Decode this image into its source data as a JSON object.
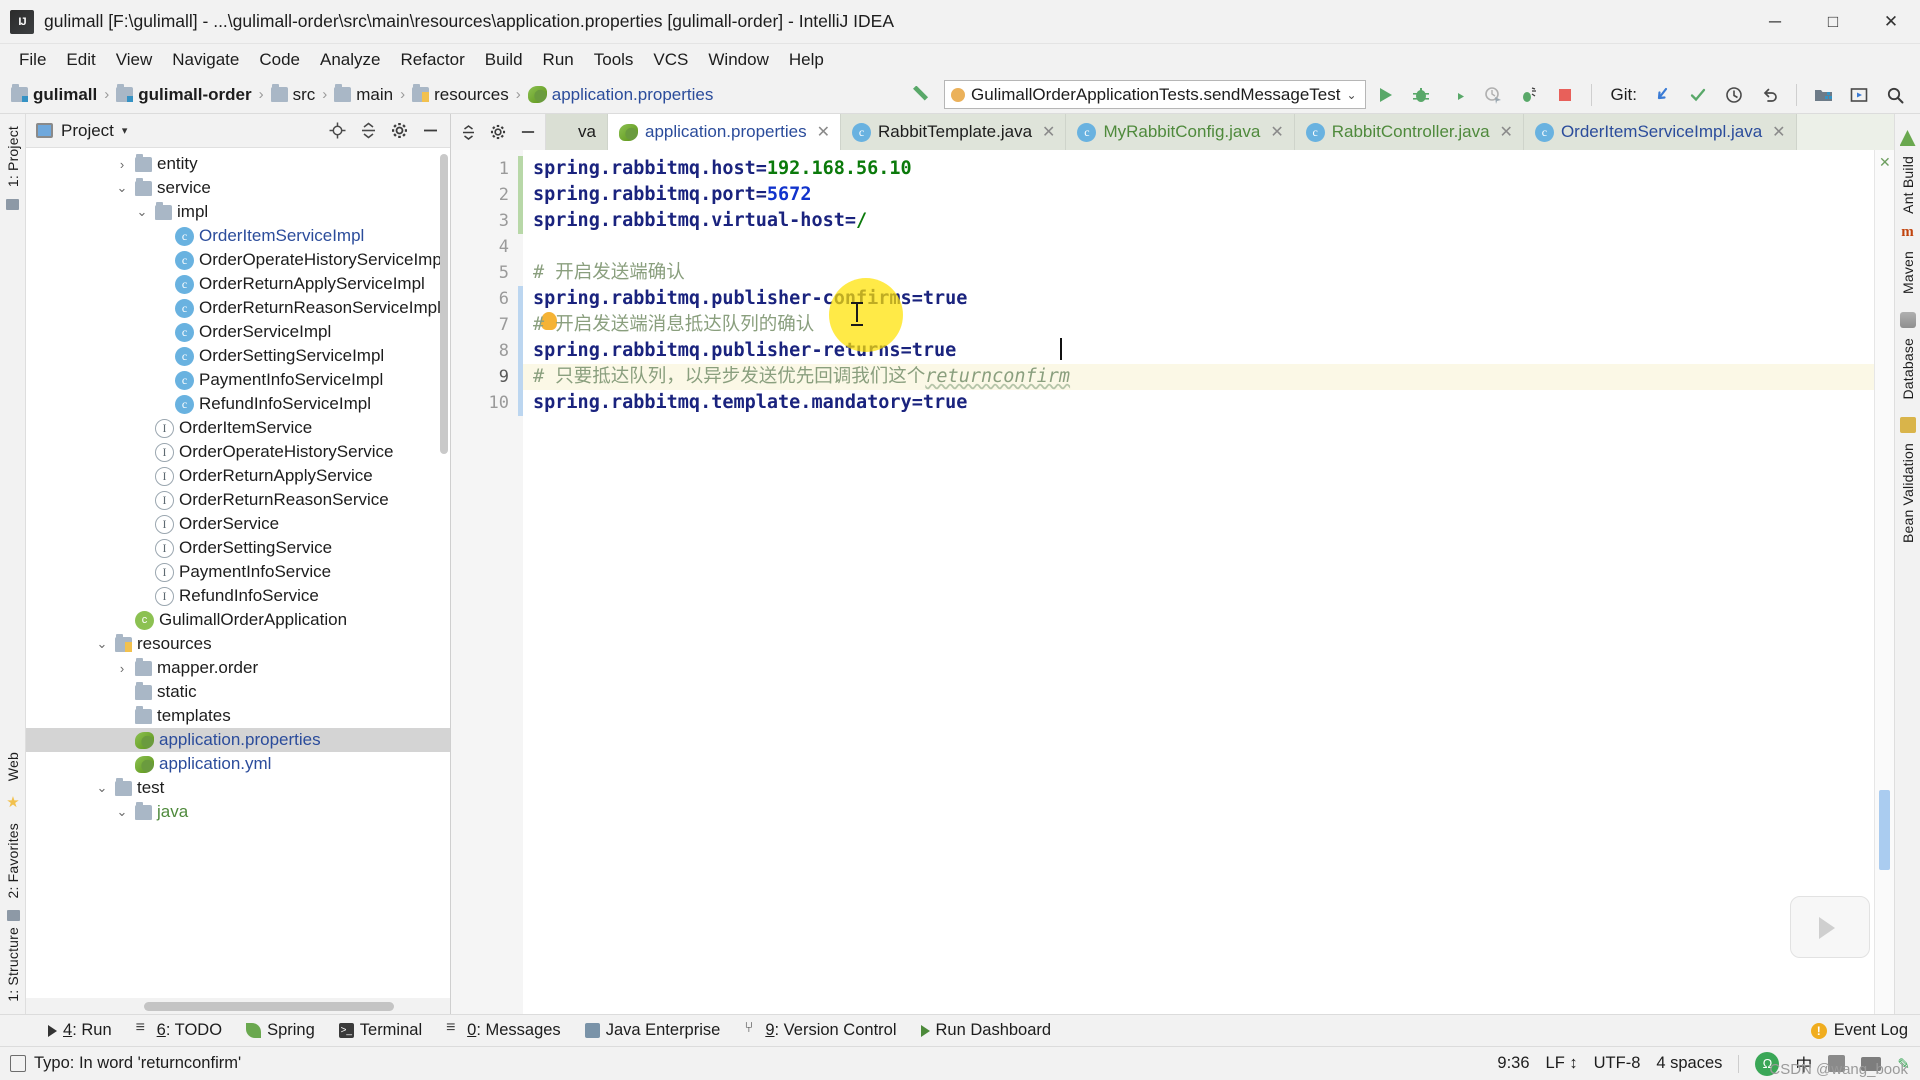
{
  "window": {
    "title": "gulimall [F:\\gulimall] - ...\\gulimall-order\\src\\main\\resources\\application.properties [gulimall-order] - IntelliJ IDEA",
    "logo_text": "IJ",
    "minimize": "─",
    "maximize": "□",
    "close": "✕"
  },
  "menubar": [
    "File",
    "Edit",
    "View",
    "Navigate",
    "Code",
    "Analyze",
    "Refactor",
    "Build",
    "Run",
    "Tools",
    "VCS",
    "Window",
    "Help"
  ],
  "navbar": {
    "breadcrumbs": [
      {
        "label": "gulimall",
        "icon": "module-folder-icon",
        "bold": true,
        "color": "dark"
      },
      {
        "label": "gulimall-order",
        "icon": "module-folder-icon",
        "bold": true,
        "color": "dark"
      },
      {
        "label": "src",
        "icon": "folder-icon",
        "bold": false,
        "color": "dark"
      },
      {
        "label": "main",
        "icon": "folder-icon",
        "bold": false,
        "color": "dark"
      },
      {
        "label": "resources",
        "icon": "resources-folder-icon",
        "bold": false,
        "color": "dark"
      },
      {
        "label": "application.properties",
        "icon": "properties-file-icon",
        "bold": false,
        "color": "blue"
      }
    ],
    "separator": "›",
    "run_config": "GulimallOrderApplicationTests.sendMessageTest",
    "run_config_chevron": "⌄",
    "git_label": "Git:",
    "toolbar_icons": [
      "run-icon",
      "debug-icon",
      "run-with-coverage-icon",
      "profile-icon",
      "run-tests-icon",
      "stop-icon",
      "git-update-icon",
      "git-commit-icon",
      "git-history-icon",
      "git-rollback-icon",
      "project-structure-icon",
      "run-anything-icon",
      "search-everywhere-icon"
    ]
  },
  "left_strip": {
    "project_label": "1: Project",
    "structure_label": "1: Structure",
    "favorites_label": "2: Favorites",
    "web_label": "Web"
  },
  "right_strip": {
    "items": [
      "Ant Build",
      "Maven",
      "Database",
      "Bean Validation"
    ]
  },
  "project_pane": {
    "title": "Project",
    "caret": "▾",
    "tools": [
      "locate-icon",
      "collapse-all-icon",
      "settings-icon",
      "hide-icon"
    ],
    "tree": [
      {
        "label": "entity",
        "icon": "folder-icon",
        "indent": 4,
        "twisty": "›",
        "selected": false,
        "color": "dark"
      },
      {
        "label": "service",
        "icon": "folder-icon",
        "indent": 4,
        "twisty": "⌄",
        "selected": false,
        "color": "dark"
      },
      {
        "label": "impl",
        "icon": "folder-icon",
        "indent": 5,
        "twisty": "⌄",
        "selected": false,
        "color": "dark"
      },
      {
        "label": "OrderItemServiceImpl",
        "icon": "class-icon",
        "indent": 6,
        "twisty": "",
        "selected": false,
        "color": "blue"
      },
      {
        "label": "OrderOperateHistoryServiceImpl",
        "icon": "class-icon",
        "indent": 6,
        "twisty": "",
        "selected": false,
        "color": "dark"
      },
      {
        "label": "OrderReturnApplyServiceImpl",
        "icon": "class-icon",
        "indent": 6,
        "twisty": "",
        "selected": false,
        "color": "dark"
      },
      {
        "label": "OrderReturnReasonServiceImpl",
        "icon": "class-icon",
        "indent": 6,
        "twisty": "",
        "selected": false,
        "color": "dark"
      },
      {
        "label": "OrderServiceImpl",
        "icon": "class-icon",
        "indent": 6,
        "twisty": "",
        "selected": false,
        "color": "dark"
      },
      {
        "label": "OrderSettingServiceImpl",
        "icon": "class-icon",
        "indent": 6,
        "twisty": "",
        "selected": false,
        "color": "dark"
      },
      {
        "label": "PaymentInfoServiceImpl",
        "icon": "class-icon",
        "indent": 6,
        "twisty": "",
        "selected": false,
        "color": "dark"
      },
      {
        "label": "RefundInfoServiceImpl",
        "icon": "class-icon",
        "indent": 6,
        "twisty": "",
        "selected": false,
        "color": "dark"
      },
      {
        "label": "OrderItemService",
        "icon": "interface-icon",
        "indent": 5,
        "twisty": "",
        "selected": false,
        "color": "dark"
      },
      {
        "label": "OrderOperateHistoryService",
        "icon": "interface-icon",
        "indent": 5,
        "twisty": "",
        "selected": false,
        "color": "dark"
      },
      {
        "label": "OrderReturnApplyService",
        "icon": "interface-icon",
        "indent": 5,
        "twisty": "",
        "selected": false,
        "color": "dark"
      },
      {
        "label": "OrderReturnReasonService",
        "icon": "interface-icon",
        "indent": 5,
        "twisty": "",
        "selected": false,
        "color": "dark"
      },
      {
        "label": "OrderService",
        "icon": "interface-icon",
        "indent": 5,
        "twisty": "",
        "selected": false,
        "color": "dark"
      },
      {
        "label": "OrderSettingService",
        "icon": "interface-icon",
        "indent": 5,
        "twisty": "",
        "selected": false,
        "color": "dark"
      },
      {
        "label": "PaymentInfoService",
        "icon": "interface-icon",
        "indent": 5,
        "twisty": "",
        "selected": false,
        "color": "dark"
      },
      {
        "label": "RefundInfoService",
        "icon": "interface-icon",
        "indent": 5,
        "twisty": "",
        "selected": false,
        "color": "dark"
      },
      {
        "label": "GulimallOrderApplication",
        "icon": "spring-class-icon",
        "indent": 4,
        "twisty": "",
        "selected": false,
        "color": "dark"
      },
      {
        "label": "resources",
        "icon": "resources-folder-icon",
        "indent": 3,
        "twisty": "⌄",
        "selected": false,
        "color": "dark"
      },
      {
        "label": "mapper.order",
        "icon": "folder-icon",
        "indent": 4,
        "twisty": "›",
        "selected": false,
        "color": "dark"
      },
      {
        "label": "static",
        "icon": "folder-icon",
        "indent": 4,
        "twisty": "",
        "selected": false,
        "color": "dark"
      },
      {
        "label": "templates",
        "icon": "folder-icon",
        "indent": 4,
        "twisty": "",
        "selected": false,
        "color": "dark"
      },
      {
        "label": "application.properties",
        "icon": "properties-file-icon",
        "indent": 4,
        "twisty": "",
        "selected": true,
        "color": "blue"
      },
      {
        "label": "application.yml",
        "icon": "properties-file-icon",
        "indent": 4,
        "twisty": "",
        "selected": false,
        "color": "blue"
      },
      {
        "label": "test",
        "icon": "folder-icon",
        "indent": 3,
        "twisty": "⌄",
        "selected": false,
        "color": "dark"
      },
      {
        "label": "java",
        "icon": "folder-icon",
        "indent": 4,
        "twisty": "⌄",
        "selected": false,
        "color": "green"
      }
    ]
  },
  "editor": {
    "tabs": [
      {
        "label": "va",
        "icon": "java-file-icon",
        "active": false,
        "partial": true,
        "color": "dim",
        "close": "✕"
      },
      {
        "label": "application.properties",
        "icon": "properties-file-icon",
        "active": true,
        "partial": false,
        "color": "blue",
        "close": "✕"
      },
      {
        "label": "RabbitTemplate.java",
        "icon": "class-icon",
        "active": false,
        "partial": false,
        "color": "dark",
        "close": "✕"
      },
      {
        "label": "MyRabbitConfig.java",
        "icon": "class-icon",
        "active": false,
        "partial": false,
        "color": "green",
        "close": "✕"
      },
      {
        "label": "RabbitController.java",
        "icon": "class-icon",
        "active": false,
        "partial": false,
        "color": "green",
        "close": "✕"
      },
      {
        "label": "OrderItemServiceImpl.java",
        "icon": "class-icon",
        "active": false,
        "partial": false,
        "color": "blue",
        "close": "✕"
      }
    ],
    "tab_controls": [
      "collapse-icon",
      "settings-icon",
      "hide-icon"
    ],
    "tab_overflow": "≡↓",
    "lines": [
      {
        "n": "1",
        "highlight": false,
        "parts": [
          {
            "t": "spring.rabbitmq.host",
            "c": "k"
          },
          {
            "t": "=",
            "c": "eq"
          },
          {
            "t": "192.168.56.10",
            "c": "v"
          }
        ]
      },
      {
        "n": "2",
        "highlight": false,
        "parts": [
          {
            "t": "spring.rabbitmq.port",
            "c": "k"
          },
          {
            "t": "=",
            "c": "eq"
          },
          {
            "t": "5672",
            "c": "vb"
          }
        ]
      },
      {
        "n": "3",
        "highlight": false,
        "parts": [
          {
            "t": "spring.rabbitmq.virtual-host",
            "c": "k"
          },
          {
            "t": "=",
            "c": "eq"
          },
          {
            "t": "/",
            "c": "v"
          }
        ]
      },
      {
        "n": "4",
        "highlight": false,
        "parts": []
      },
      {
        "n": "5",
        "highlight": false,
        "parts": [
          {
            "t": "# 开启发送端确认",
            "c": "cm"
          }
        ]
      },
      {
        "n": "6",
        "highlight": false,
        "parts": [
          {
            "t": "spring.rabbitmq.publisher-confirms",
            "c": "k"
          },
          {
            "t": "=",
            "c": "eq"
          },
          {
            "t": "true",
            "c": "k"
          }
        ]
      },
      {
        "n": "7",
        "highlight": false,
        "parts": [
          {
            "t": "# 开启发送端消息抵达队列的确认",
            "c": "cm"
          }
        ]
      },
      {
        "n": "8",
        "highlight": false,
        "parts": [
          {
            "t": "spring.rabbitmq.publisher-returns",
            "c": "k"
          },
          {
            "t": "=",
            "c": "eq"
          },
          {
            "t": "true",
            "c": "k"
          }
        ]
      },
      {
        "n": "9",
        "highlight": true,
        "parts": [
          {
            "t": "# 只要抵达队列，以异步发送优先回调我们这个",
            "c": "cm"
          },
          {
            "t": "returnconfirm",
            "c": "cm-i"
          }
        ]
      },
      {
        "n": "10",
        "highlight": false,
        "parts": [
          {
            "t": "spring.rabbitmq.template.mandatory",
            "c": "k"
          },
          {
            "t": "=",
            "c": "eq"
          },
          {
            "t": "true",
            "c": "k"
          }
        ]
      }
    ]
  },
  "tool_windows": [
    {
      "label": "4: Run",
      "mnemonic": "4",
      "icon": "run-icon"
    },
    {
      "label": "6: TODO",
      "mnemonic": "6",
      "icon": "todo-icon"
    },
    {
      "label": "Spring",
      "mnemonic": "",
      "icon": "spring-leaf-icon"
    },
    {
      "label": "Terminal",
      "mnemonic": "",
      "icon": "terminal-icon"
    },
    {
      "label": "0: Messages",
      "mnemonic": "0",
      "icon": "messages-icon"
    },
    {
      "label": "Java Enterprise",
      "mnemonic": "",
      "icon": "java-enterprise-icon"
    },
    {
      "label": "9: Version Control",
      "mnemonic": "9",
      "icon": "version-control-icon"
    },
    {
      "label": "Run Dashboard",
      "mnemonic": "",
      "icon": "run-dashboard-icon"
    }
  ],
  "event_log": {
    "label": "Event Log",
    "icon": "event-log-icon"
  },
  "statusbar": {
    "message": "Typo: In word 'returnconfirm'",
    "message_icon": "inspection-icon",
    "caret_position": "9:36",
    "line_separator": "LF",
    "line_separator_chevron": "↕",
    "encoding": "UTF-8",
    "indent": "4 spaces",
    "ime": {
      "badge": "Ω",
      "lang": "中",
      "icons": [
        "ime-panel-icon",
        "keyboard-icon",
        "pen-icon"
      ]
    }
  },
  "watermark": "CSDN @wang_book"
}
